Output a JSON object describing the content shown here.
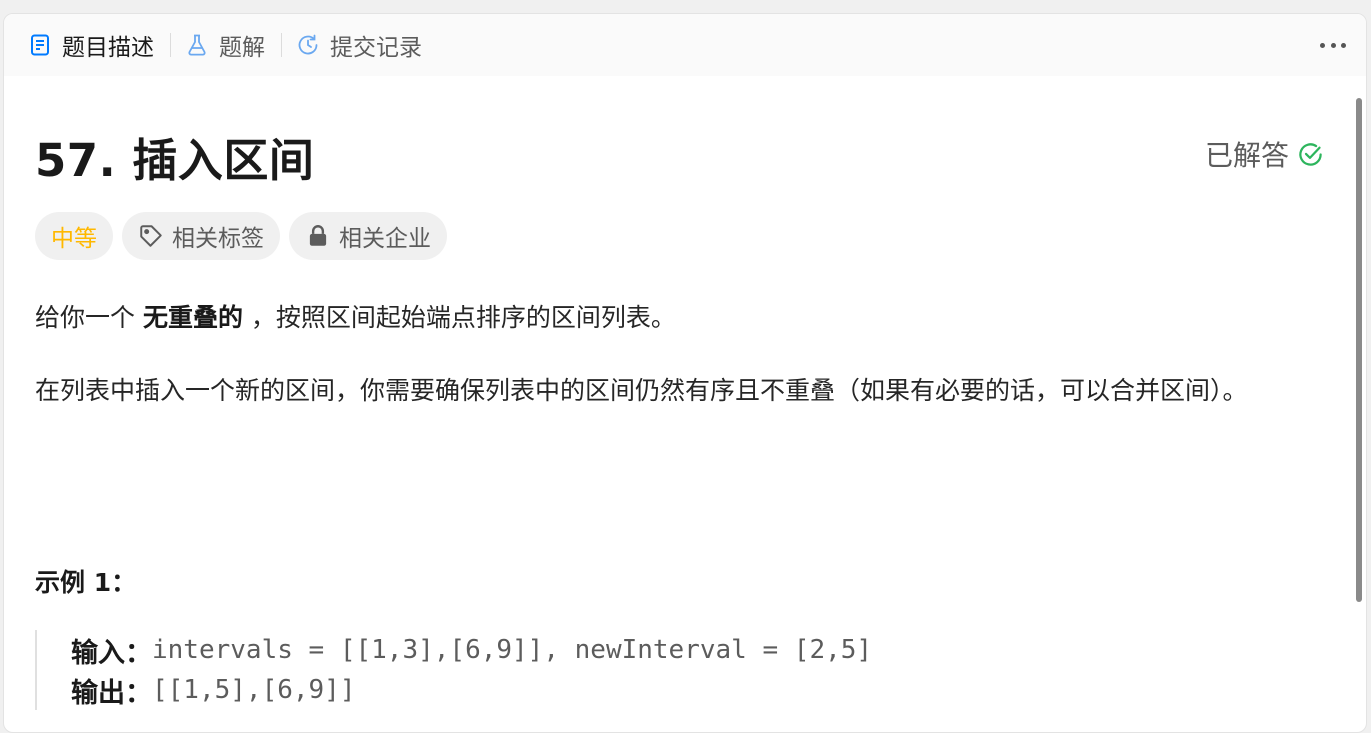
{
  "tabs": [
    {
      "label": "题目描述",
      "icon": "document-icon"
    },
    {
      "label": "题解",
      "icon": "flask-icon"
    },
    {
      "label": "提交记录",
      "icon": "history-icon"
    }
  ],
  "problem": {
    "title": "57. 插入区间",
    "status": "已解答"
  },
  "tags": {
    "difficulty": "中等",
    "related_tags": "相关标签",
    "related_companies": "相关企业"
  },
  "description": {
    "p1_before": "给你一个 ",
    "p1_bold": "无重叠的",
    "p1_after": " ，按照区间起始端点排序的区间列表。",
    "p2": "在列表中插入一个新的区间，你需要确保列表中的区间仍然有序且不重叠（如果有必要的话，可以合并区间）。"
  },
  "example": {
    "title": "示例 1：",
    "input_label": "输入：",
    "input_value": "intervals = [[1,3],[6,9]], newInterval = [2,5]",
    "output_label": "输出：",
    "output_value": "[[1,5],[6,9]]"
  },
  "colors": {
    "accent_blue": "#007aff",
    "difficulty_medium": "#ffb800",
    "solved_green": "#2db55d"
  }
}
